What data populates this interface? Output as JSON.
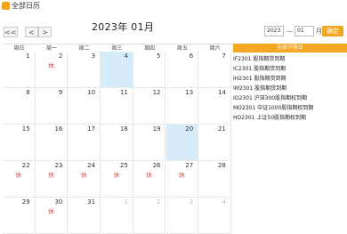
{
  "app": {
    "title": "全部日历"
  },
  "toolbar": {
    "prev_year_label": "<<",
    "prev_month_label": "<",
    "next_month_label": ">",
    "month_title": "2023年 01月",
    "year_value": "2023",
    "month_value": "01",
    "separator": "—",
    "month_unit": "月",
    "go_label": "确定"
  },
  "weekdays": [
    "周日",
    "周一",
    "周二",
    "周三",
    "周四",
    "周五",
    "周六"
  ],
  "weeks": [
    [
      {
        "num": "1",
        "mark": "",
        "hl": false
      },
      {
        "num": "2",
        "mark": "休",
        "hl": false
      },
      {
        "num": "3",
        "mark": "",
        "hl": false
      },
      {
        "num": "4",
        "mark": "",
        "hl": true
      },
      {
        "num": "5",
        "mark": "",
        "hl": false
      },
      {
        "num": "6",
        "mark": "",
        "hl": false
      },
      {
        "num": "7",
        "mark": "",
        "hl": false
      }
    ],
    [
      {
        "num": "8",
        "mark": "",
        "hl": false
      },
      {
        "num": "9",
        "mark": "",
        "hl": false
      },
      {
        "num": "10",
        "mark": "",
        "hl": false
      },
      {
        "num": "11",
        "mark": "",
        "hl": false
      },
      {
        "num": "12",
        "mark": "",
        "hl": false
      },
      {
        "num": "13",
        "mark": "",
        "hl": false
      },
      {
        "num": "14",
        "mark": "",
        "hl": false
      }
    ],
    [
      {
        "num": "15",
        "mark": "",
        "hl": false
      },
      {
        "num": "16",
        "mark": "",
        "hl": false
      },
      {
        "num": "17",
        "mark": "",
        "hl": false
      },
      {
        "num": "18",
        "mark": "",
        "hl": false
      },
      {
        "num": "19",
        "mark": "",
        "hl": false
      },
      {
        "num": "20",
        "mark": "",
        "hl": true
      },
      {
        "num": "21",
        "mark": "",
        "hl": false
      }
    ],
    [
      {
        "num": "22",
        "mark": "休",
        "hl": false
      },
      {
        "num": "23",
        "mark": "休",
        "hl": false
      },
      {
        "num": "24",
        "mark": "休",
        "hl": false
      },
      {
        "num": "25",
        "mark": "休",
        "hl": false
      },
      {
        "num": "26",
        "mark": "休",
        "hl": false
      },
      {
        "num": "27",
        "mark": "休",
        "hl": false
      },
      {
        "num": "28",
        "mark": "",
        "hl": false
      }
    ],
    [
      {
        "num": "29",
        "mark": "",
        "hl": false
      },
      {
        "num": "30",
        "mark": "休",
        "hl": false
      },
      {
        "num": "31",
        "mark": "",
        "hl": false
      },
      {
        "num": "1",
        "mark": "",
        "hl": false,
        "other": true
      },
      {
        "num": "2",
        "mark": "",
        "hl": false,
        "other": true
      },
      {
        "num": "3",
        "mark": "",
        "hl": false,
        "other": true
      },
      {
        "num": "4",
        "mark": "",
        "hl": false,
        "other": true
      }
    ]
  ],
  "side_panel": {
    "header": "全部节假日",
    "items": [
      "IF2301 股指期货到期",
      "IC2301 股指期货到期",
      "IH2301 股指期货到期",
      "IM2301 股指期货到期",
      "IO2301 沪深300股指期权到期",
      "MO2301 中证1000股指期权到期",
      "HO2301 上证50股指期权到期"
    ]
  }
}
